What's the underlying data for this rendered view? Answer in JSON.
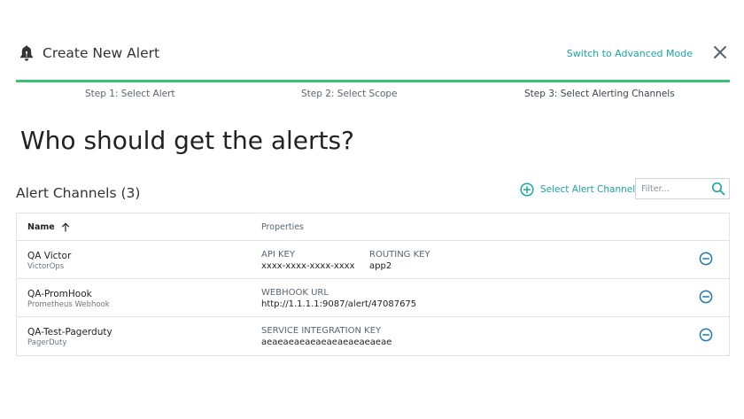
{
  "header": {
    "title": "Create New Alert",
    "switch_link": "Switch to Advanced Mode"
  },
  "steps": [
    {
      "label": "Step 1: Select Alert"
    },
    {
      "label": "Step 2: Select Scope"
    },
    {
      "label": "Step 3: Select Alerting Channels"
    }
  ],
  "headline": "Who should get the alerts?",
  "channels_section": {
    "title": "Alert Channels (3)",
    "select_button": "Select Alert Channels",
    "filter_placeholder": "Filter..."
  },
  "table": {
    "columns": {
      "name": "Name",
      "properties": "Properties"
    },
    "rows": [
      {
        "name": "QA Victor",
        "type": "VictorOps",
        "props": [
          {
            "label": "API KEY",
            "value": "xxxx-xxxx-xxxx-xxxx"
          },
          {
            "label": "ROUTING KEY",
            "value": "app2"
          }
        ]
      },
      {
        "name": "QA-PromHook",
        "type": "Prometheus Webhook",
        "props": [
          {
            "label": "WEBHOOK URL",
            "value": "http://1.1.1.1:9087/alert/47087675"
          }
        ]
      },
      {
        "name": "QA-Test-Pagerduty",
        "type": "PagerDuty",
        "props": [
          {
            "label": "SERVICE INTEGRATION KEY",
            "value": "aeaeaeaeaeaeaeaeaeaeaeae"
          }
        ]
      }
    ]
  },
  "icons": {
    "bell": "bell-icon",
    "close": "close-icon",
    "plus": "plus-circle-icon",
    "search": "search-icon",
    "sort": "arrow-up-icon",
    "remove": "minus-circle-icon"
  },
  "colors": {
    "accent": "#1aa5a5",
    "progress": "#3cc076",
    "remove": "#1f78b4"
  }
}
